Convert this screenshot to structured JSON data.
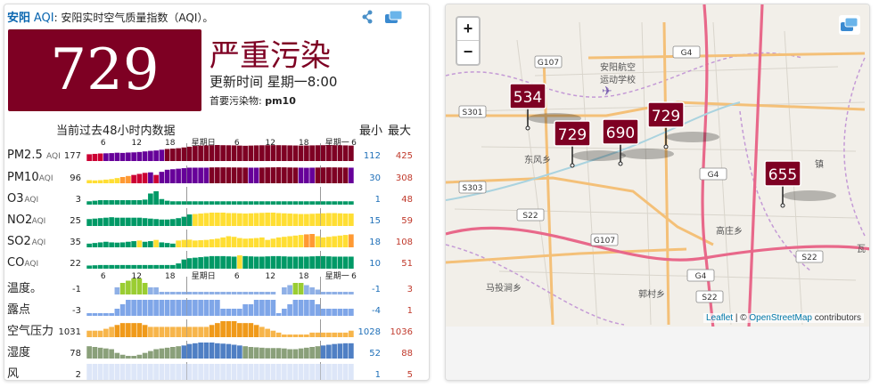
{
  "header": {
    "city": "安阳",
    "aqi_word": "AQI",
    "subtitle": ": 安阳实时空气质量指数（AQI）。"
  },
  "current": {
    "aqi": "729",
    "status": "严重污染",
    "updated": "更新时间 星期一8:00",
    "dominant_label": "首要污染物:",
    "dominant_value": "pm10",
    "color": "#7e0023"
  },
  "history": {
    "title": "当前过去48小时内数据",
    "min_label": "最小",
    "max_label": "最大",
    "axis_ticks": [
      "6",
      "12",
      "18",
      "星期日",
      "6",
      "12",
      "18",
      "星期一",
      "6"
    ],
    "rows": [
      {
        "name": "PM2.5",
        "unit": "AQI",
        "current": "177",
        "min": "112",
        "max": "425",
        "kind": "aqi",
        "values": [
          180,
          190,
          200,
          205,
          210,
          220,
          215,
          225,
          230,
          240,
          255,
          270,
          280,
          300,
          320,
          330,
          340,
          360,
          380,
          400,
          410,
          415,
          420,
          425,
          420,
          418,
          415,
          410,
          405,
          410,
          415,
          418,
          420,
          422,
          420,
          418,
          415,
          412,
          410,
          412,
          415,
          418,
          420,
          422,
          420,
          418,
          415,
          410
        ]
      },
      {
        "name": "PM10",
        "unit": "AQI",
        "current": "96",
        "min": "30",
        "max": "308",
        "kind": "aqi",
        "values": [
          60,
          55,
          60,
          70,
          80,
          100,
          120,
          140,
          160,
          180,
          200,
          210,
          160,
          220,
          260,
          270,
          280,
          290,
          300,
          300,
          300,
          300,
          305,
          306,
          306,
          305,
          304,
          303,
          302,
          300,
          300,
          302,
          305,
          306,
          308,
          306,
          304,
          302,
          300,
          298,
          300,
          302,
          304,
          306,
          305,
          304,
          302,
          300
        ]
      },
      {
        "name": "O3",
        "unit": "AQI",
        "current": "3",
        "min": "1",
        "max": "48",
        "kind": "aqi",
        "values": [
          12,
          14,
          16,
          16,
          16,
          16,
          16,
          16,
          16,
          16,
          18,
          40,
          48,
          20,
          14,
          12,
          12,
          12,
          12,
          12,
          12,
          12,
          12,
          12,
          12,
          12,
          12,
          12,
          12,
          12,
          12,
          12,
          12,
          12,
          12,
          12,
          12,
          12,
          12,
          12,
          12,
          12,
          12,
          12,
          12,
          12,
          12,
          12
        ]
      },
      {
        "name": "NO2",
        "unit": "AQI",
        "current": "25",
        "min": "15",
        "max": "59",
        "kind": "aqi",
        "values": [
          30,
          32,
          34,
          36,
          38,
          36,
          36,
          36,
          36,
          36,
          34,
          32,
          30,
          28,
          28,
          30,
          34,
          40,
          50,
          52,
          54,
          56,
          58,
          58,
          58,
          56,
          56,
          55,
          54,
          55,
          56,
          57,
          58,
          58,
          56,
          55,
          54,
          53,
          52,
          52,
          53,
          54,
          55,
          56,
          56,
          55,
          54,
          54
        ]
      },
      {
        "name": "SO2",
        "unit": "AQI",
        "current": "35",
        "min": "18",
        "max": "108",
        "kind": "aqi",
        "values": [
          30,
          35,
          40,
          45,
          40,
          38,
          40,
          45,
          50,
          55,
          45,
          50,
          60,
          40,
          35,
          30,
          55,
          60,
          62,
          55,
          58,
          60,
          65,
          70,
          80,
          90,
          85,
          75,
          70,
          72,
          75,
          80,
          60,
          70,
          80,
          85,
          90,
          95,
          100,
          105,
          108,
          90,
          80,
          85,
          90,
          95,
          100,
          105
        ]
      },
      {
        "name": "CO",
        "unit": "AQI",
        "current": "22",
        "min": "10",
        "max": "51",
        "kind": "aqi",
        "values": [
          12,
          13,
          14,
          14,
          14,
          14,
          14,
          14,
          14,
          14,
          14,
          14,
          14,
          14,
          14,
          14,
          20,
          35,
          40,
          42,
          44,
          46,
          48,
          48,
          48,
          47,
          46,
          51,
          48,
          47,
          46,
          46,
          47,
          48,
          48,
          47,
          46,
          46,
          46,
          46,
          47,
          48,
          48,
          47,
          46,
          46,
          46,
          46
        ]
      },
      {
        "name": "温度。",
        "unit": "",
        "current": "-1",
        "min": "-1",
        "max": "3",
        "kind": "temp",
        "values": [
          null,
          null,
          null,
          null,
          null,
          1,
          2,
          2.5,
          3,
          3,
          2,
          1,
          1,
          0,
          0,
          0,
          0,
          0,
          0,
          0,
          0,
          0,
          0,
          0,
          0,
          0,
          0,
          0,
          0,
          0,
          0,
          0,
          0,
          0,
          null,
          1,
          1.5,
          2,
          2,
          1.5,
          1,
          0.5,
          0,
          0,
          0,
          0,
          0,
          0
        ]
      },
      {
        "name": "露点",
        "unit": "",
        "current": "-3",
        "min": "-4",
        "max": "1",
        "kind": "dew",
        "values": [
          -3,
          -3,
          -3,
          -3,
          -3,
          -2,
          -1,
          0,
          0,
          0,
          0,
          0,
          0,
          0,
          0,
          0,
          0,
          0,
          0,
          0,
          0,
          0,
          0,
          0,
          -2,
          -2,
          -2,
          -2,
          -1,
          -1,
          0,
          0,
          0,
          0,
          -3,
          -2,
          -1,
          0,
          0,
          0,
          0,
          -1,
          -2,
          -2,
          -2,
          -2,
          -2,
          -2
        ]
      },
      {
        "name": "空气压力",
        "unit": "",
        "current": "1031",
        "min": "1028",
        "max": "1036",
        "kind": "pressure",
        "values": [
          1031,
          1031,
          1031,
          1032,
          1033,
          1034,
          1035,
          1035,
          1035,
          1035,
          1034,
          1033,
          1033,
          1033,
          1033,
          1033,
          1033,
          1033,
          1033,
          1033,
          1033,
          1033,
          1034,
          1035,
          1036,
          1036,
          1036,
          1035,
          1035,
          1035,
          1034,
          1033,
          1032,
          1031,
          1030,
          1029,
          1029,
          1029,
          1029,
          1029,
          1030,
          1030,
          1030,
          1030,
          1030,
          1030,
          1030,
          1031
        ]
      },
      {
        "name": "湿度",
        "unit": "",
        "current": "78",
        "min": "52",
        "max": "88",
        "kind": "humidity",
        "values": [
          78,
          76,
          74,
          72,
          70,
          60,
          55,
          52,
          52,
          55,
          60,
          65,
          70,
          72,
          74,
          76,
          78,
          80,
          84,
          86,
          88,
          88,
          88,
          86,
          85,
          84,
          82,
          80,
          78,
          76,
          75,
          74,
          73,
          73,
          73,
          72,
          70,
          70,
          72,
          74,
          76,
          78,
          80,
          82,
          84,
          85,
          86,
          86
        ]
      },
      {
        "name": "风",
        "unit": "",
        "current": "2",
        "min": "1",
        "max": "5",
        "kind": "wind",
        "values": [
          2,
          2,
          2,
          2,
          2,
          2,
          2,
          2,
          2,
          2,
          2,
          2,
          2,
          2,
          2,
          2,
          2,
          2,
          2,
          2,
          2,
          2,
          2,
          2,
          2,
          2,
          2,
          2,
          2,
          2,
          2,
          2,
          2,
          2,
          2,
          2,
          2,
          2,
          2,
          2,
          2,
          2,
          2,
          2,
          2,
          2,
          2,
          2
        ]
      }
    ]
  },
  "map": {
    "zoom_in": "+",
    "zoom_out": "−",
    "attribution_leaflet": "Leaflet",
    "attribution_sep": " | © ",
    "attribution_osm": "OpenStreetMap",
    "attribution_tail": " contributors",
    "markers": [
      "534",
      "729",
      "690",
      "729",
      "655"
    ],
    "places": [
      "安阳航空",
      "运动学校",
      "东风乡",
      "高庄乡",
      "马投涧乡",
      "郭村乡",
      "瓦",
      "镇"
    ],
    "roads": [
      "G107",
      "G4",
      "S301",
      "S303",
      "S22",
      "G107",
      "G4",
      "G4",
      "S22",
      "S22"
    ]
  }
}
